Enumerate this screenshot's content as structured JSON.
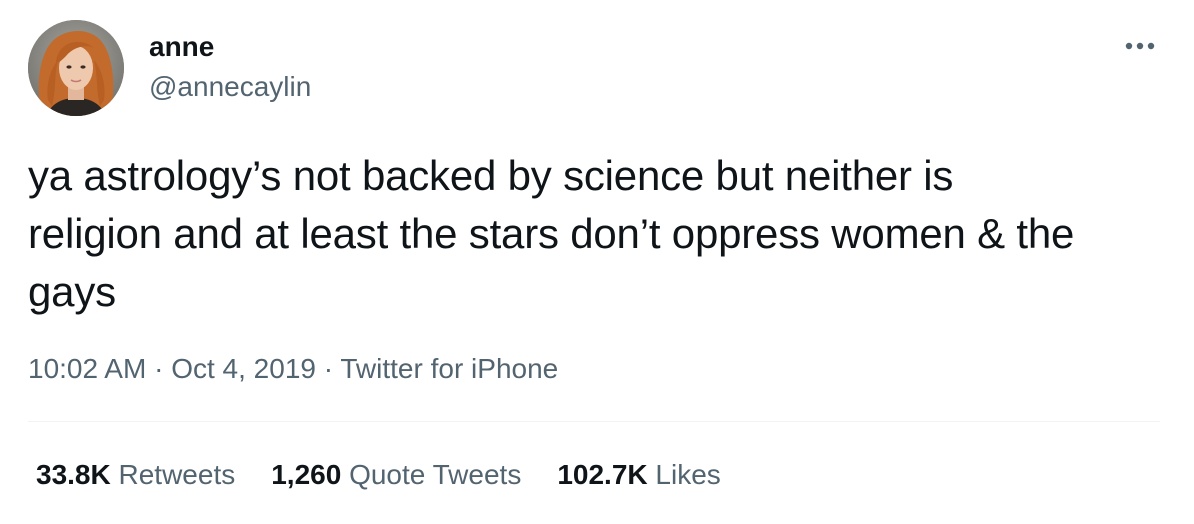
{
  "author": {
    "display_name": "anne",
    "handle": "@annecaylin",
    "avatar_icon": "profile-photo"
  },
  "menu": {
    "icon": "more-horizontal-icon"
  },
  "tweet": {
    "line1": "ya astrology’s not backed by science but neither is",
    "line2": "religion and at least the stars don’t oppress women & the",
    "line3": "gays"
  },
  "meta": {
    "time": "10:02 AM",
    "separator": "·",
    "date": "Oct 4, 2019",
    "source": "Twitter for iPhone"
  },
  "stats": [
    {
      "count": "33.8K",
      "label": "Retweets"
    },
    {
      "count": "1,260",
      "label": "Quote Tweets"
    },
    {
      "count": "102.7K",
      "label": "Likes"
    }
  ],
  "colors": {
    "text_primary": "#0f1419",
    "text_secondary": "#536471",
    "divider": "#eff3f4",
    "background": "#ffffff"
  }
}
